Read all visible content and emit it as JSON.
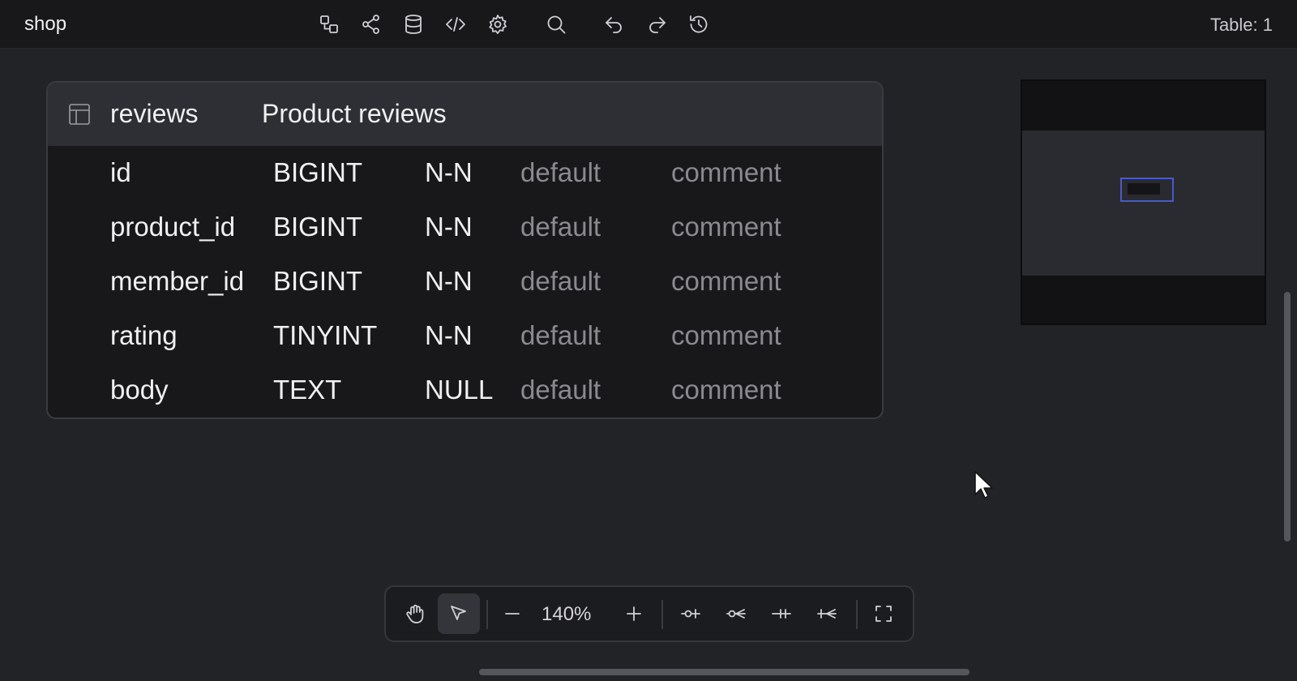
{
  "header": {
    "app_title": "shop",
    "table_count": "Table: 1",
    "tools": [
      {
        "icon": "relationship-icon"
      },
      {
        "icon": "share-icon"
      },
      {
        "icon": "database-icon"
      },
      {
        "icon": "code-icon"
      },
      {
        "icon": "gear-icon"
      },
      {
        "icon": "search-icon"
      },
      {
        "icon": "undo-icon"
      },
      {
        "icon": "redo-icon"
      },
      {
        "icon": "history-icon"
      }
    ]
  },
  "table": {
    "name": "reviews",
    "comment": "Product reviews",
    "columns": [
      {
        "name": "id",
        "type": "BIGINT",
        "nullable": "N-N",
        "default": "default",
        "comment": "comment"
      },
      {
        "name": "product_id",
        "type": "BIGINT",
        "nullable": "N-N",
        "default": "default",
        "comment": "comment"
      },
      {
        "name": "member_id",
        "type": "BIGINT",
        "nullable": "N-N",
        "default": "default",
        "comment": "comment"
      },
      {
        "name": "rating",
        "type": "TINYINT",
        "nullable": "N-N",
        "default": "default",
        "comment": "comment"
      },
      {
        "name": "body",
        "type": "TEXT",
        "nullable": "NULL",
        "default": "default",
        "comment": "comment"
      }
    ]
  },
  "zoom_bar": {
    "zoom_level": "140%"
  },
  "colors": {
    "accent": "#4a5ac8",
    "background": "#222327",
    "topbar": "#18181b"
  }
}
